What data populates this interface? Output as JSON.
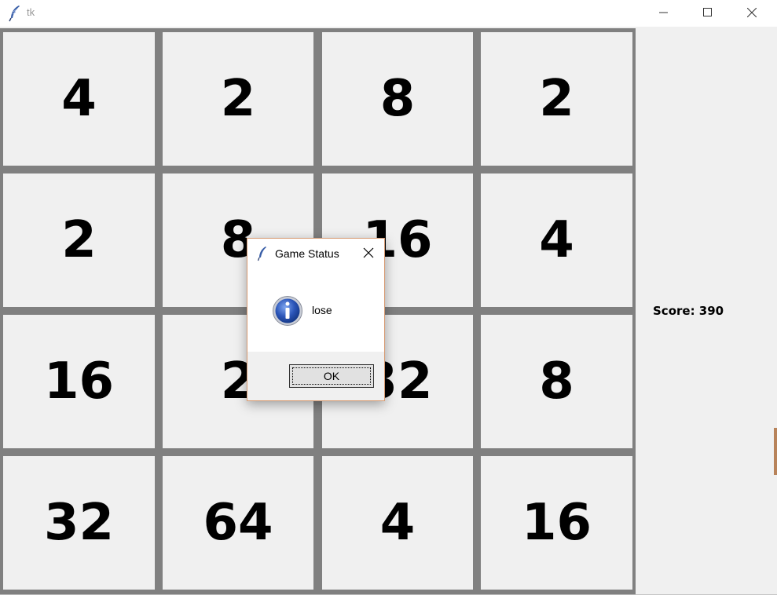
{
  "window": {
    "title": "tk",
    "icon": "feather-icon",
    "controls": [
      "minimize-icon",
      "maximize-icon",
      "close-icon"
    ]
  },
  "board": {
    "rows": [
      [
        "4",
        "2",
        "8",
        "2"
      ],
      [
        "2",
        "8",
        "16",
        "4"
      ],
      [
        "16",
        "2",
        "32",
        "8"
      ],
      [
        "32",
        "64",
        "4",
        "16"
      ]
    ]
  },
  "score": {
    "label": "Score: 390"
  },
  "dialog": {
    "title": "Game Status",
    "icon": "info-icon",
    "message": "lose",
    "ok_label": "OK"
  },
  "colors": {
    "grid": "#808080",
    "tile": "#f0f0f0",
    "dialog_border": "#d79b73",
    "info_icon": "#2b55b8"
  }
}
